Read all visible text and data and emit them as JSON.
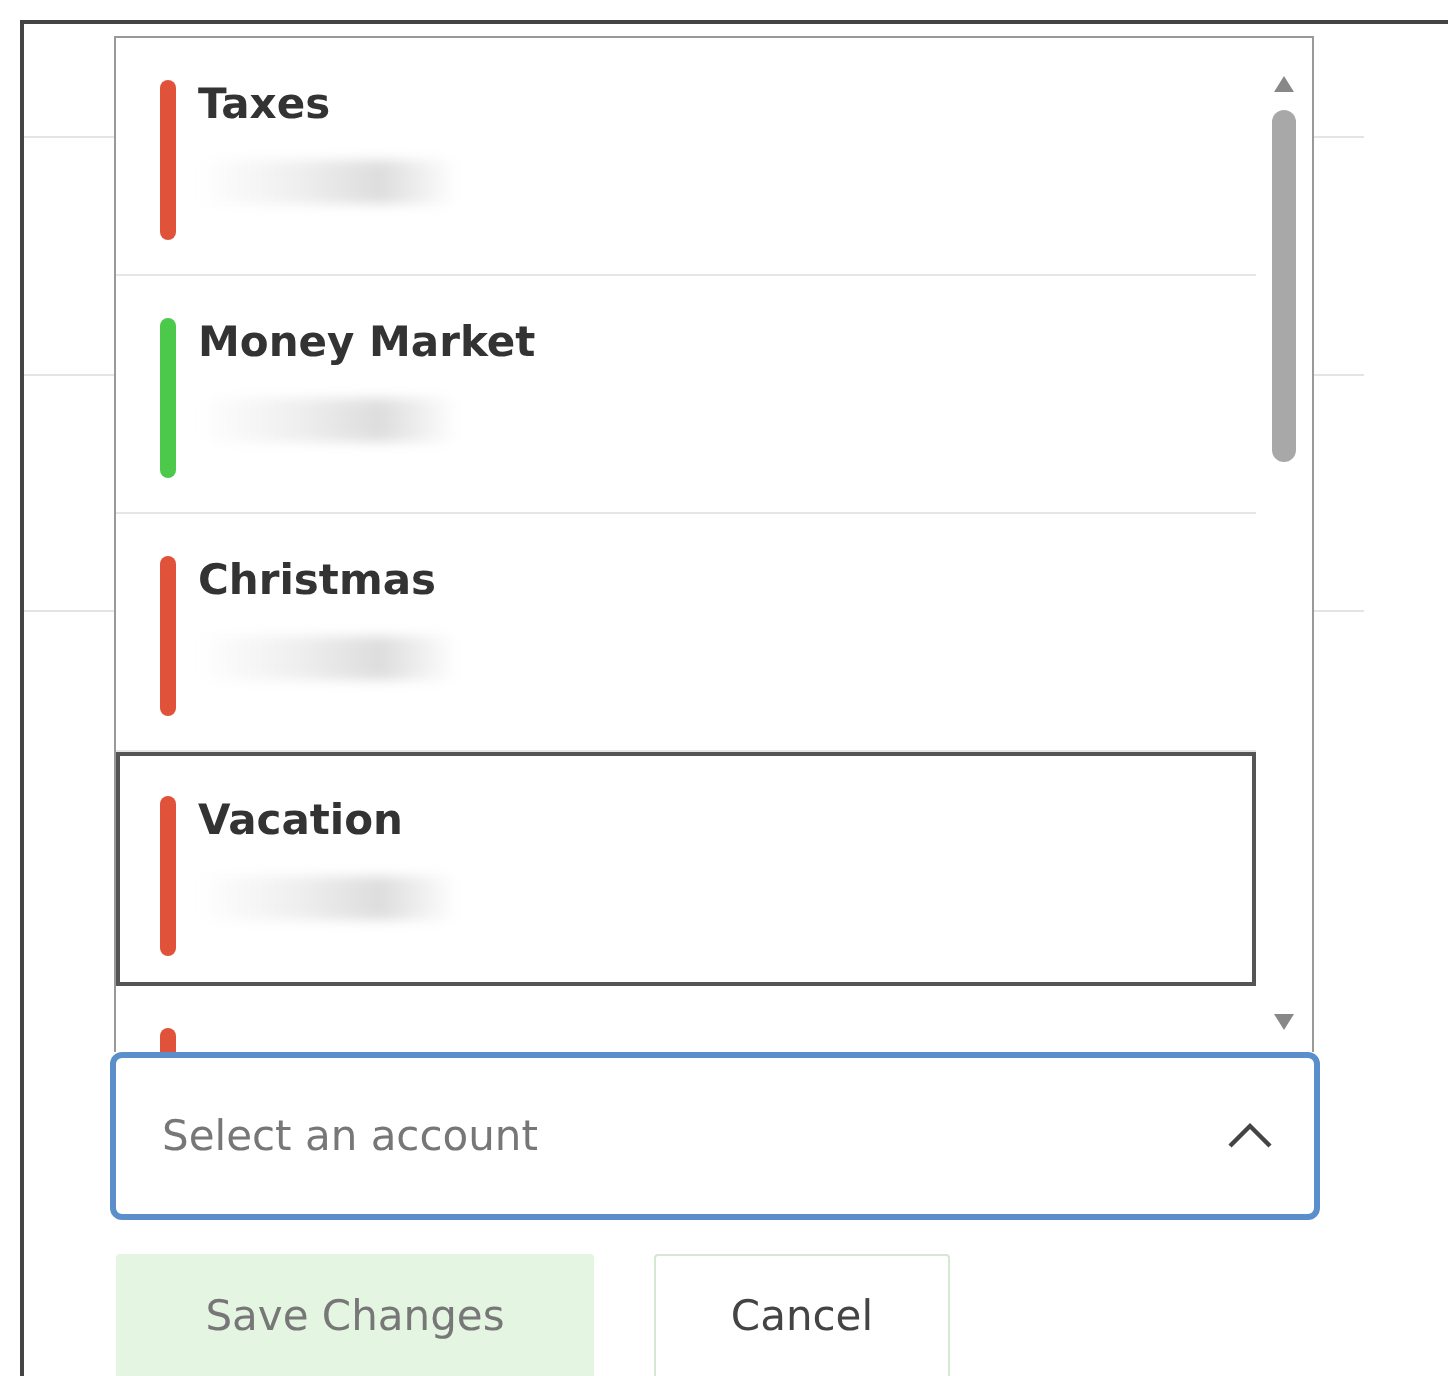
{
  "account_select": {
    "placeholder": "Select an account",
    "expanded": true,
    "options": [
      {
        "name": "Taxes",
        "color": "#e0533a",
        "highlighted": false
      },
      {
        "name": "Money Market",
        "color": "#4cc94a",
        "highlighted": false
      },
      {
        "name": "Christmas",
        "color": "#e0533a",
        "highlighted": false
      },
      {
        "name": "Vacation",
        "color": "#e0533a",
        "highlighted": true
      },
      {
        "color": "#e0533a",
        "highlighted": false
      }
    ]
  },
  "buttons": [
    {
      "label": "Save Changes",
      "kind": "primary",
      "disabled": true
    },
    {
      "label": "Cancel",
      "kind": "secondary",
      "disabled": false
    }
  ]
}
